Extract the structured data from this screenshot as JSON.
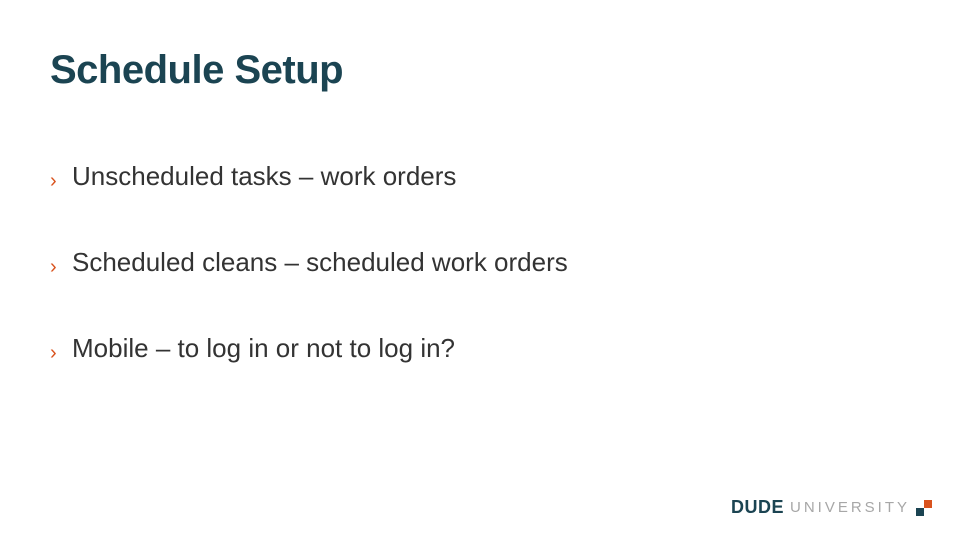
{
  "title": "Schedule Setup",
  "bullets": [
    {
      "text": "Unscheduled tasks – work orders"
    },
    {
      "text": "Scheduled cleans – scheduled work orders"
    },
    {
      "text": "Mobile – to log in or not to log in?"
    }
  ],
  "footer": {
    "brand_bold": "DUDE",
    "brand_light": "UNIVERSITY"
  },
  "colors": {
    "heading": "#1b4452",
    "accent": "#d9531e",
    "body": "#333333",
    "logo_light": "#a7a7a7"
  }
}
